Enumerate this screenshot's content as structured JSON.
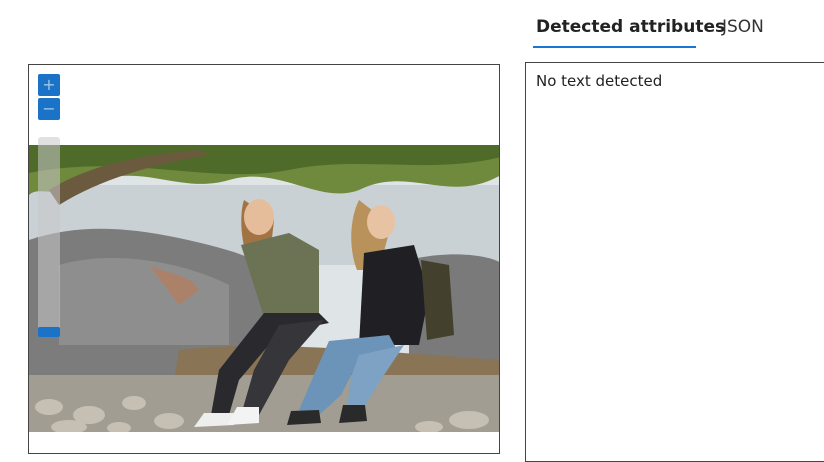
{
  "tabs": {
    "detected": "Detected attributes",
    "json": "JSON"
  },
  "viewer": {
    "zoom_in": "+",
    "zoom_out": "−",
    "zoom_level": 0.05
  },
  "result": {
    "message": "No text detected"
  },
  "colors": {
    "accent": "#1976d2"
  }
}
